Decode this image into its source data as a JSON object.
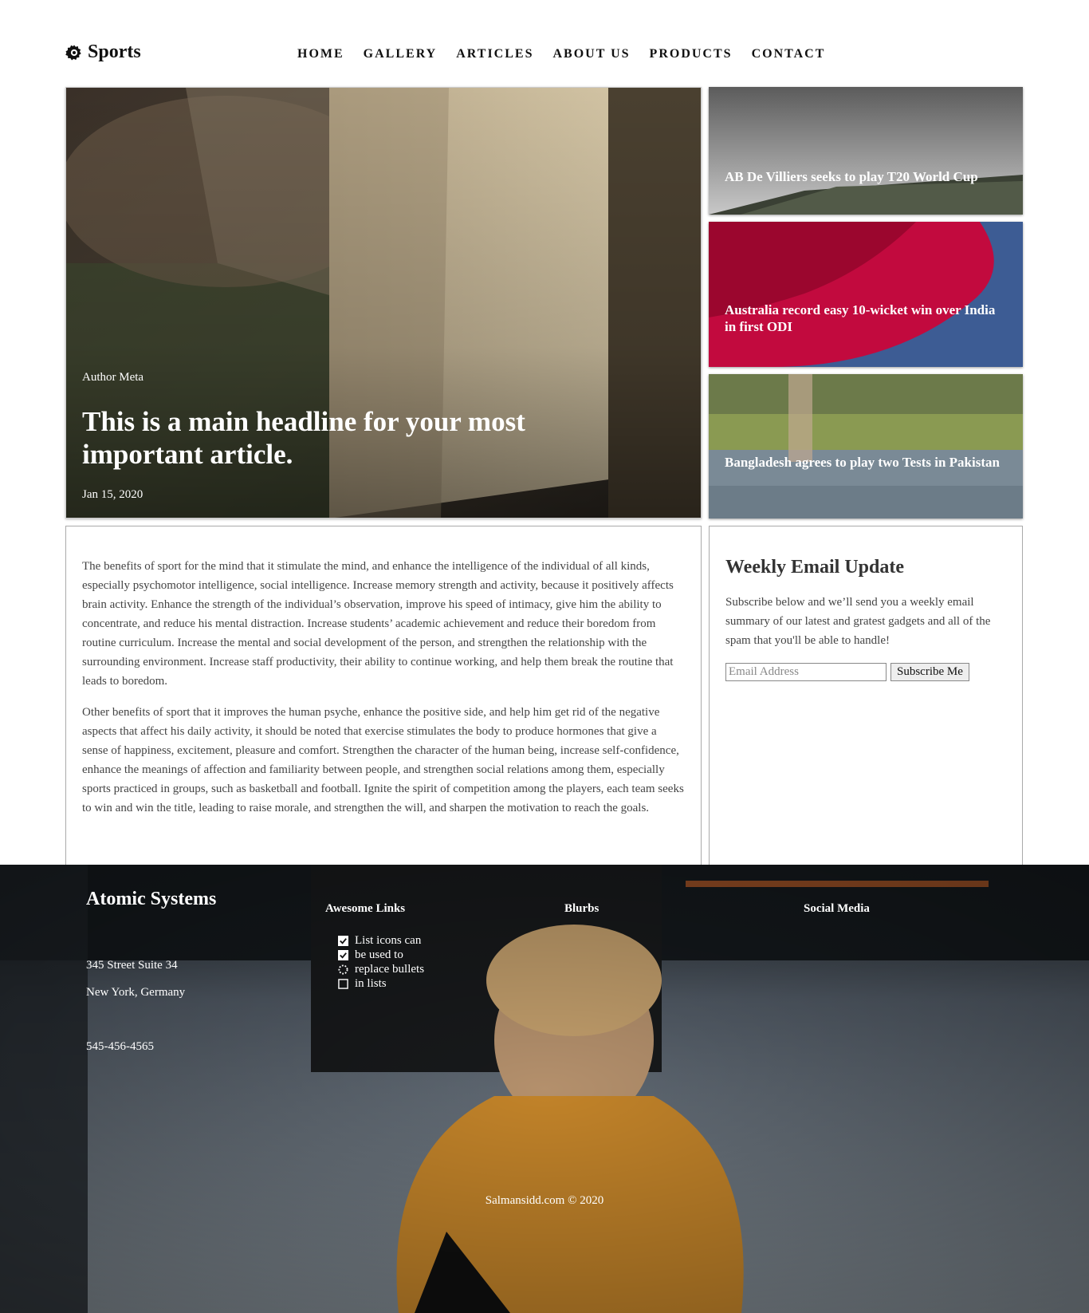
{
  "brand": {
    "name": "Sports",
    "icon": "gear-icon"
  },
  "nav": [
    "HOME",
    "GALLERY",
    "ARTICLES",
    "ABOUT US",
    "PRODUCTS",
    "CONTACT"
  ],
  "hero": {
    "meta": "Author Meta",
    "title": "This is a main headline for your most important article.",
    "date": "Jan 15, 2020"
  },
  "cards": [
    {
      "title": "AB De Villiers seeks to play T20 World Cup"
    },
    {
      "title": "Australia record easy 10-wicket win over India in first ODI"
    },
    {
      "title": "Bangladesh agrees to play two Tests in Pakistan"
    }
  ],
  "article": {
    "paragraphs": [
      "The benefits of sport for the mind that it stimulate the mind, and enhance the intelligence of the individual of all kinds, especially psychomotor intelligence, social intelligence. Increase memory strength and activity, because it positively affects brain activity. Enhance the strength of the individual’s observation, improve his speed of intimacy, give him the ability to concentrate, and reduce his mental distraction. Increase students’ academic achievement and reduce their boredom from routine curriculum. Increase the mental and social development of the person, and strengthen the relationship with the surrounding environment. Increase staff productivity, their ability to continue working, and help them break the routine that leads to boredom.",
      "Other benefits of sport that it improves the human psyche, enhance the positive side, and help him get rid of the negative aspects that affect his daily activity, it should be noted that exercise stimulates the body to produce hormones that give a sense of happiness, excitement, pleasure and comfort. Strengthen the character of the human being, increase self-confidence, enhance the meanings of affection and familiarity between people, and strengthen social relations among them, especially sports practiced in groups, such as basketball and football. Ignite the spirit of competition among the players, each team seeks to win and win the title, leading to raise morale, and strengthen the will, and sharpen the motivation to reach the goals."
    ]
  },
  "newsletter": {
    "title": "Weekly Email Update",
    "text": "Subscribe below and we’ll send you a weekly email summary of our latest and gratest gadgets and all of the spam that you'll be able to handle!",
    "placeholder": "Email Address",
    "button": "Subscribe Me"
  },
  "footer": {
    "brand": "Atomic Systems",
    "address1": "345 Street Suite 34",
    "address2": "New York, Germany",
    "phone": "545-456-4565",
    "col_links": "Awesome Links",
    "col_blurbs": "Blurbs",
    "col_social": "Social Media",
    "list": [
      {
        "text": "List icons can",
        "icon": "checked-box-icon"
      },
      {
        "text": "be used to",
        "icon": "checked-box-icon"
      },
      {
        "text": "replace bullets",
        "icon": "spinner-icon"
      },
      {
        "text": "in lists",
        "icon": "empty-box-icon"
      }
    ],
    "copyright": "Salmansidd.com © 2020"
  }
}
